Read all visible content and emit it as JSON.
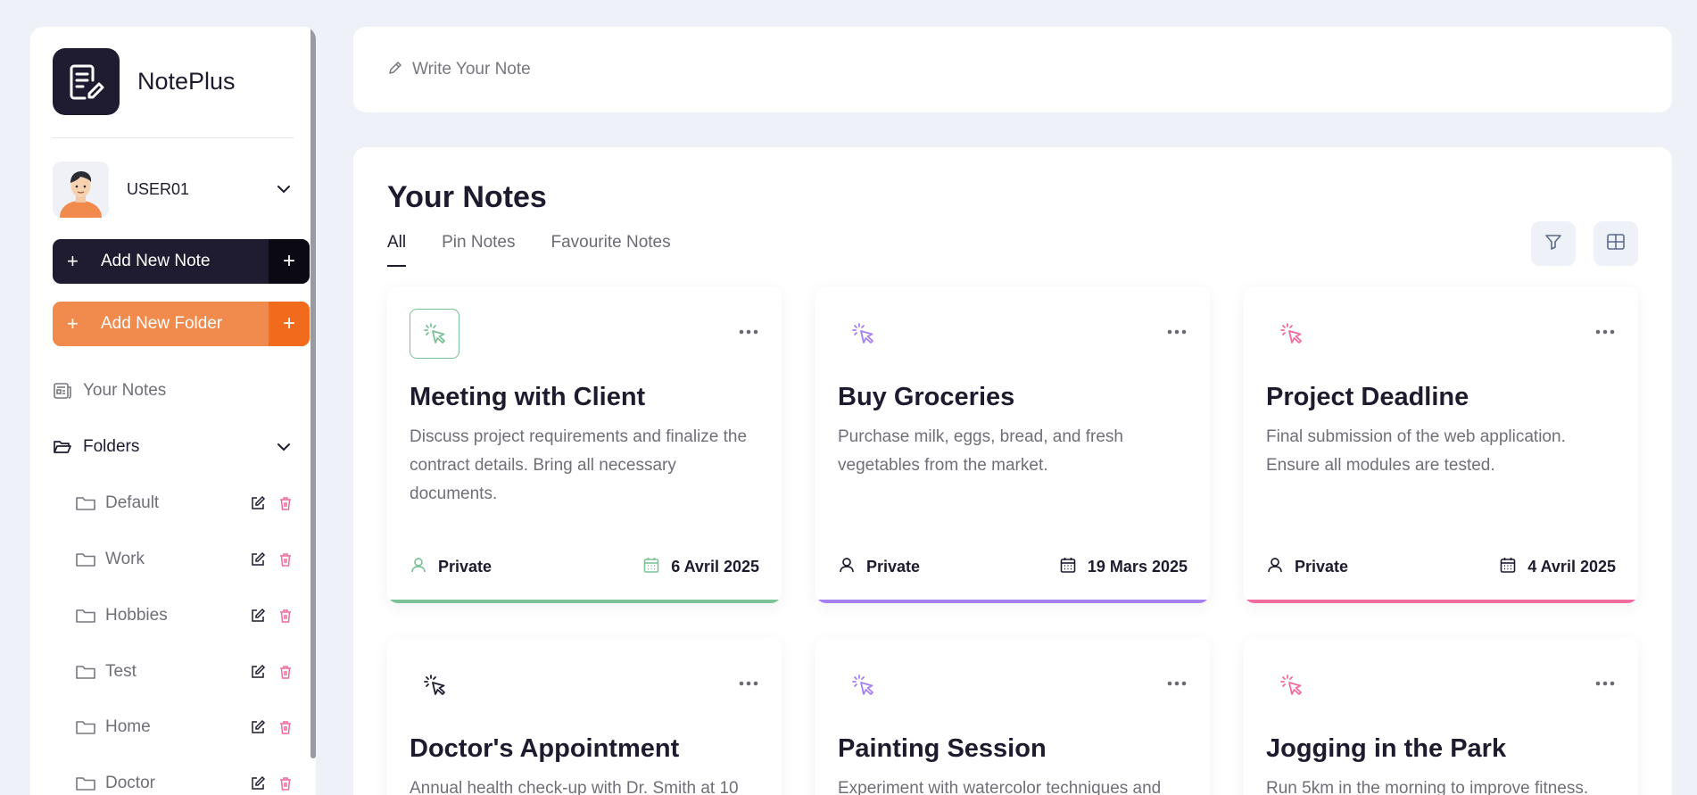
{
  "app": {
    "name": "NotePlus"
  },
  "user": {
    "name": "USER01"
  },
  "sidebar": {
    "add_note_label": "Add New Note",
    "add_folder_label": "Add New Folder",
    "your_notes_label": "Your Notes",
    "folders_label": "Folders",
    "folders": [
      {
        "name": "Default"
      },
      {
        "name": "Work"
      },
      {
        "name": "Hobbies"
      },
      {
        "name": "Test"
      },
      {
        "name": "Home"
      },
      {
        "name": "Doctor"
      }
    ]
  },
  "editor": {
    "placeholder": "Write Your Note"
  },
  "notes_panel": {
    "title": "Your Notes",
    "tabs": [
      {
        "label": "All"
      },
      {
        "label": "Pin Notes"
      },
      {
        "label": "Favourite Notes"
      }
    ]
  },
  "notes": [
    {
      "title": "Meeting with Client",
      "description": "Discuss project requirements and finalize the contract details. Bring all necessary documents.",
      "visibility": "Private",
      "date": "6 Avril 2025",
      "color": "#7cc298"
    },
    {
      "title": "Buy Groceries",
      "description": "Purchase milk, eggs, bread, and fresh vegetables from the market.",
      "visibility": "Private",
      "date": "19 Mars 2025",
      "color": "#a67ff0"
    },
    {
      "title": "Project Deadline",
      "description": "Final submission of the web application. Ensure all modules are tested.",
      "visibility": "Private",
      "date": "4 Avril 2025",
      "color": "#f06b9e"
    },
    {
      "title": "Doctor's Appointment",
      "description": "Annual health check-up with Dr. Smith at 10",
      "color": "#1e1b2e"
    },
    {
      "title": "Painting Session",
      "description": "Experiment with watercolor techniques and",
      "color": "#a67ff0"
    },
    {
      "title": "Jogging in the Park",
      "description": "Run 5km in the morning to improve fitness.",
      "color": "#f06b9e"
    }
  ],
  "icons": {
    "logo": "note-pen-icon",
    "note": "cursor-click-icon",
    "more": "more-dots-icon",
    "filter": "filter-icon",
    "grid": "grid-view-icon"
  }
}
